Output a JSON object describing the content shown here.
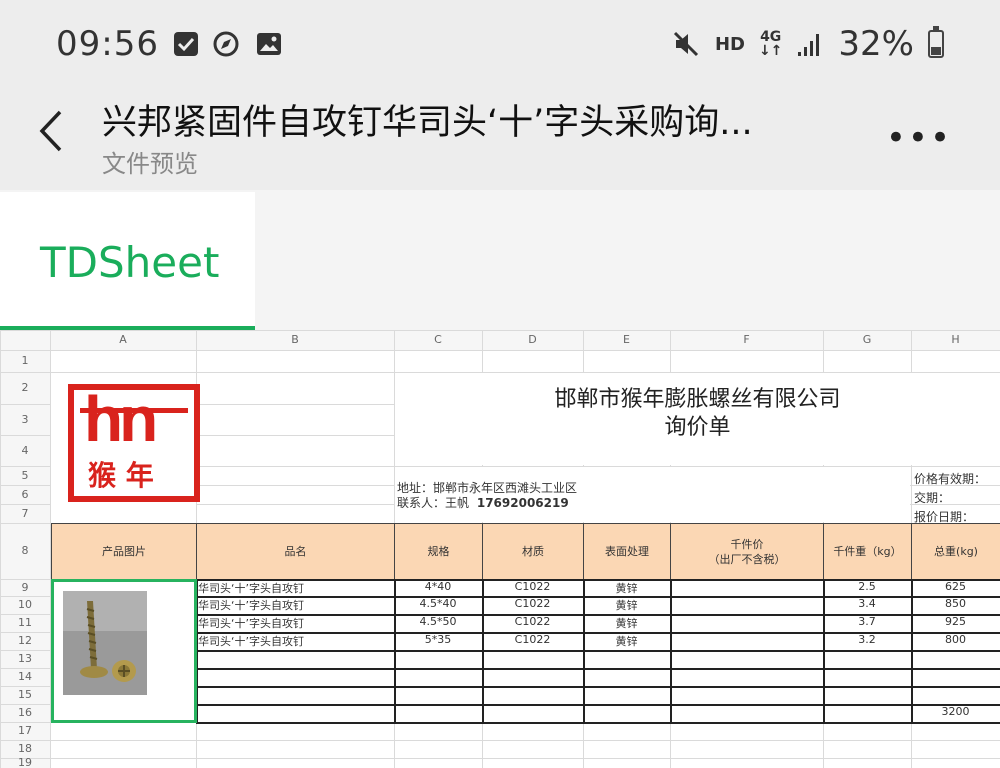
{
  "status_bar": {
    "time": "09:56",
    "hd": "HD",
    "network": "4G",
    "battery": "32%",
    "battery_level": 0.32
  },
  "header": {
    "title": "兴邦紧固件自攻钉华司头‘十’字头采购询...",
    "subtitle": "文件预览"
  },
  "tabs": [
    {
      "label": "TDSheet"
    }
  ],
  "sheet": {
    "column_letters": [
      "A",
      "B",
      "C",
      "D",
      "E",
      "F",
      "G",
      "H"
    ],
    "row_numbers": [
      "1",
      "2",
      "3",
      "4",
      "5",
      "6",
      "7",
      "8",
      "9",
      "10",
      "11",
      "12",
      "13",
      "14",
      "15",
      "16",
      "17",
      "18",
      "19"
    ],
    "company_name": "邯郸市猴年膨胀螺丝有限公司",
    "document_title": "询价单",
    "logo_text": "hn",
    "logo_subtext": "猴 年",
    "address": "地址：邯郸市永年区西滩头工业区",
    "contact_label": "联系人：王帆",
    "contact_phone": "17692006219",
    "right_labels": [
      "价格有效期：",
      "交期：",
      "报价日期："
    ],
    "headers": [
      "产品图片",
      "品名",
      "规格",
      "材质",
      "表面处理",
      "千件价",
      "千件重（kg）",
      "总重(kg)"
    ],
    "header_price_note": "（出厂不含税）",
    "rows": [
      {
        "name": "华司头‘十’字头自攻钉",
        "spec": "4*40",
        "material": "C1022",
        "surface": "黄锌",
        "weight": "2.5",
        "total": "625"
      },
      {
        "name": "华司头‘十’字头自攻钉",
        "spec": "4.5*40",
        "material": "C1022",
        "surface": "黄锌",
        "weight": "3.4",
        "total": "850"
      },
      {
        "name": "华司头‘十’字头自攻钉",
        "spec": "4.5*50",
        "material": "C1022",
        "surface": "黄锌",
        "weight": "3.7",
        "total": "925"
      },
      {
        "name": "华司头‘十’字头自攻钉",
        "spec": "5*35",
        "material": "C1022",
        "surface": "黄锌",
        "weight": "3.2",
        "total": "800"
      }
    ],
    "grand_total": "3200"
  }
}
